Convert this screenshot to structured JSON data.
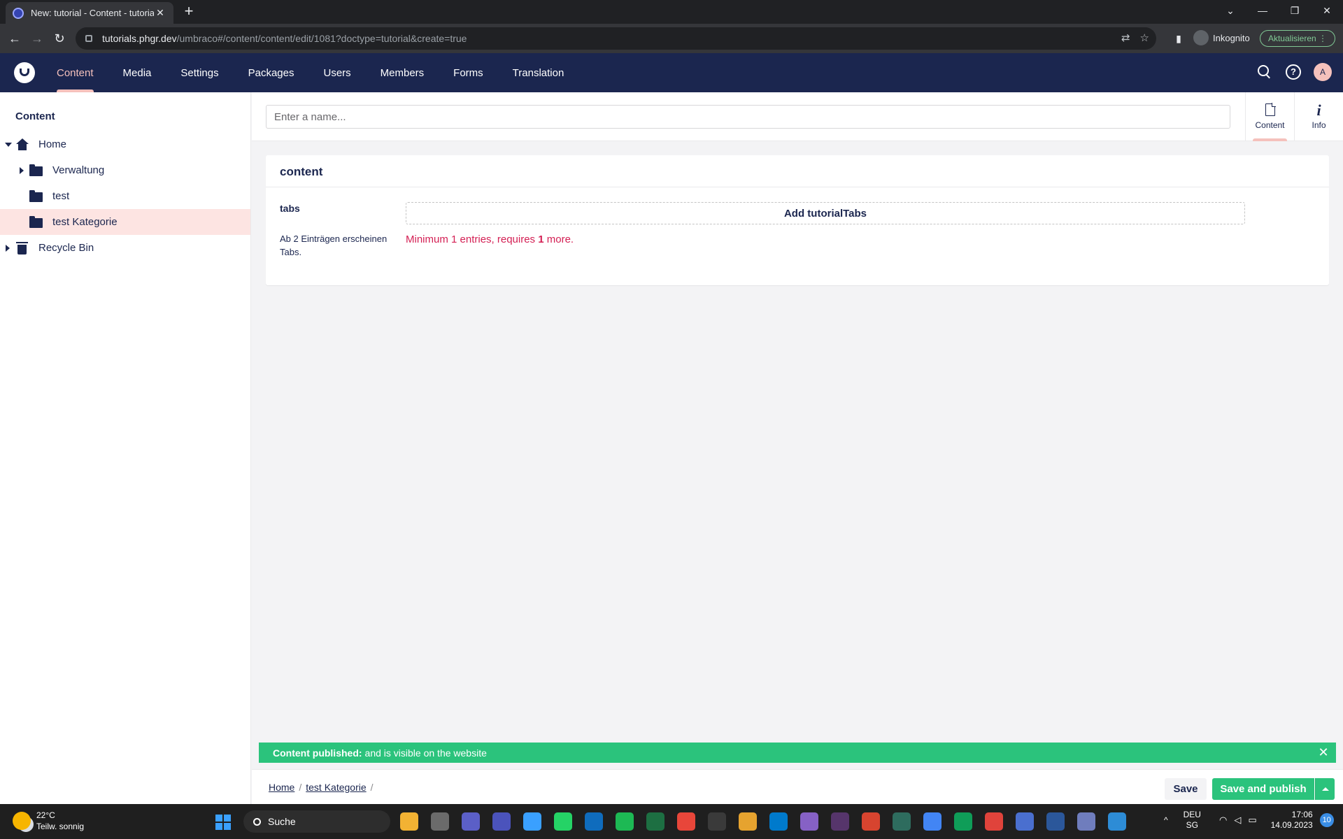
{
  "browser": {
    "tab_title": "New: tutorial - Content - tutorials",
    "url_host": "tutorials.phgr.dev",
    "url_path": "/umbraco#/content/content/edit/1081?doctype=tutorial&create=true",
    "profile_label": "Inkognito",
    "update_label": "Aktualisieren"
  },
  "header": {
    "nav": [
      {
        "label": "Content"
      },
      {
        "label": "Media"
      },
      {
        "label": "Settings"
      },
      {
        "label": "Packages"
      },
      {
        "label": "Users"
      },
      {
        "label": "Members"
      },
      {
        "label": "Forms"
      },
      {
        "label": "Translation"
      }
    ],
    "avatar_initial": "A"
  },
  "sidebar": {
    "title": "Content",
    "tree": [
      {
        "label": "Home"
      },
      {
        "label": "Verwaltung"
      },
      {
        "label": "test"
      },
      {
        "label": "test Kategorie"
      },
      {
        "label": "Recycle Bin"
      }
    ]
  },
  "editor": {
    "name_placeholder": "Enter a name...",
    "app_tabs": [
      {
        "label": "Content"
      },
      {
        "label": "Info"
      }
    ],
    "group_title": "content",
    "property": {
      "label": "tabs",
      "description": "Ab 2 Einträgen erscheinen Tabs.",
      "add_button": "Add tutorialTabs",
      "validation_pre": "Minimum 1 entries, requires",
      "validation_count": "1",
      "validation_post": "more."
    }
  },
  "notification": {
    "headline": "Content published:",
    "message": "and is visible on the website"
  },
  "footer": {
    "breadcrumbs": [
      {
        "label": "Home"
      },
      {
        "label": "test Kategorie"
      }
    ],
    "separator": "/",
    "save_label": "Save",
    "publish_label": "Save and publish"
  },
  "taskbar": {
    "temperature": "22°C",
    "weather_text": "Teilw. sonnig",
    "search_label": "Suche",
    "lang_1": "DEU",
    "lang_2": "SG",
    "time": "17:06",
    "date": "14.09.2023",
    "notification_count": "10",
    "app_colors": [
      "#f2b233",
      "#6b6b6b",
      "#5b5fc7",
      "#4b53bc",
      "#3aa0ff",
      "#25d366",
      "#0f6cbd",
      "#1db954",
      "#1d6f42",
      "#e8463a",
      "#3a3a3a",
      "#e6a32f",
      "#007acc",
      "#8661c5",
      "#56356b",
      "#d7442f",
      "#2e6c5e",
      "#4285f4",
      "#0f9d58",
      "#e0433b",
      "#4a6fcf",
      "#2b579a",
      "#6f7dbd",
      "#2d8cd6"
    ]
  }
}
